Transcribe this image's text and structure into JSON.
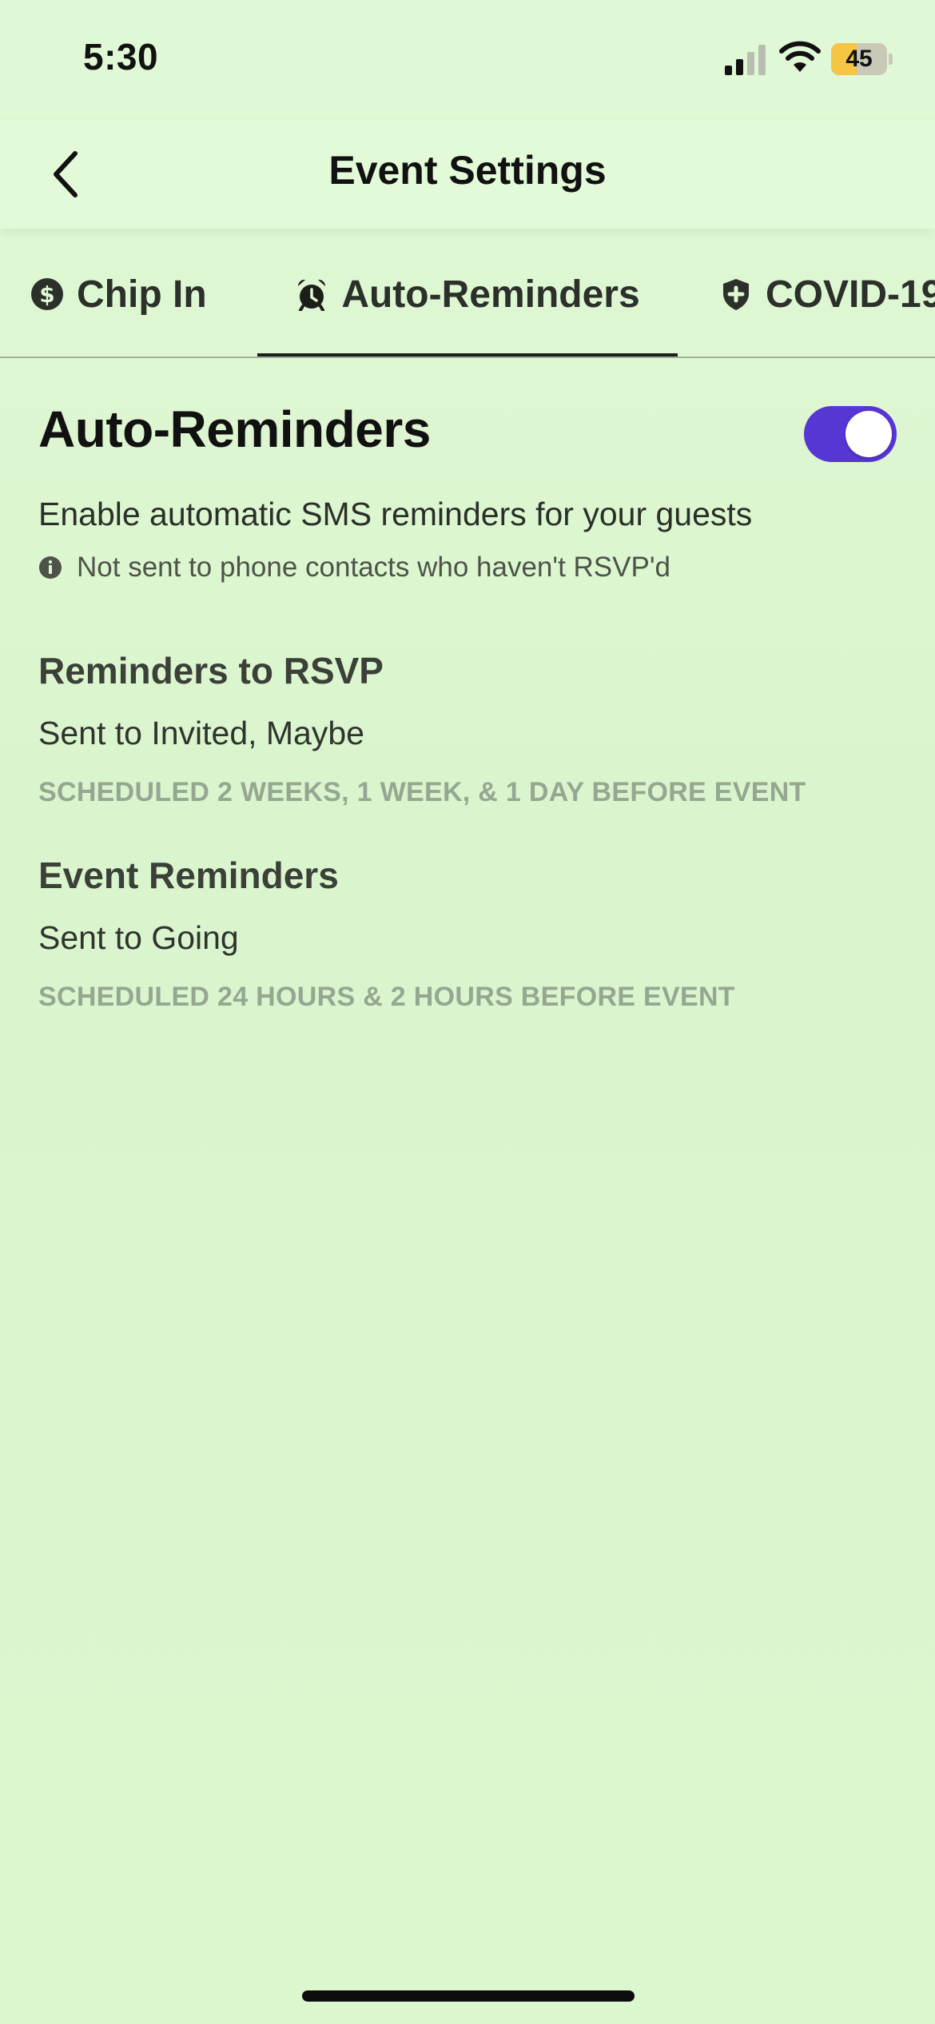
{
  "status_bar": {
    "time": "5:30",
    "battery_level": "45",
    "battery_fraction": 0.45,
    "battery_fill_color": "#f5c543",
    "icons": [
      "cellular-signal-icon",
      "wifi-icon",
      "battery-icon"
    ]
  },
  "header": {
    "title": "Event Settings",
    "back_icon": "chevron-left-icon"
  },
  "tabs": [
    {
      "label": "Chip In",
      "icon": "dollar-circle-icon",
      "active": false
    },
    {
      "label": "Auto-Reminders",
      "icon": "alarm-clock-icon",
      "active": true
    },
    {
      "label": "COVID-19",
      "icon": "shield-plus-icon",
      "active": false
    }
  ],
  "auto_reminders": {
    "title": "Auto-Reminders",
    "enabled": true,
    "toggle_color": "#5637d4",
    "description": "Enable automatic SMS reminders for your guests",
    "note": "Not sent to phone contacts who haven't RSVP'd",
    "note_icon": "info-icon"
  },
  "reminders_to_rsvp": {
    "title": "Reminders to RSVP",
    "audience": "Sent to Invited, Maybe",
    "schedule": "SCHEDULED 2 WEEKS, 1 WEEK, & 1 DAY BEFORE EVENT"
  },
  "event_reminders": {
    "title": "Event Reminders",
    "audience": "Sent to Going",
    "schedule": "SCHEDULED 24 HOURS & 2 HOURS BEFORE EVENT"
  }
}
